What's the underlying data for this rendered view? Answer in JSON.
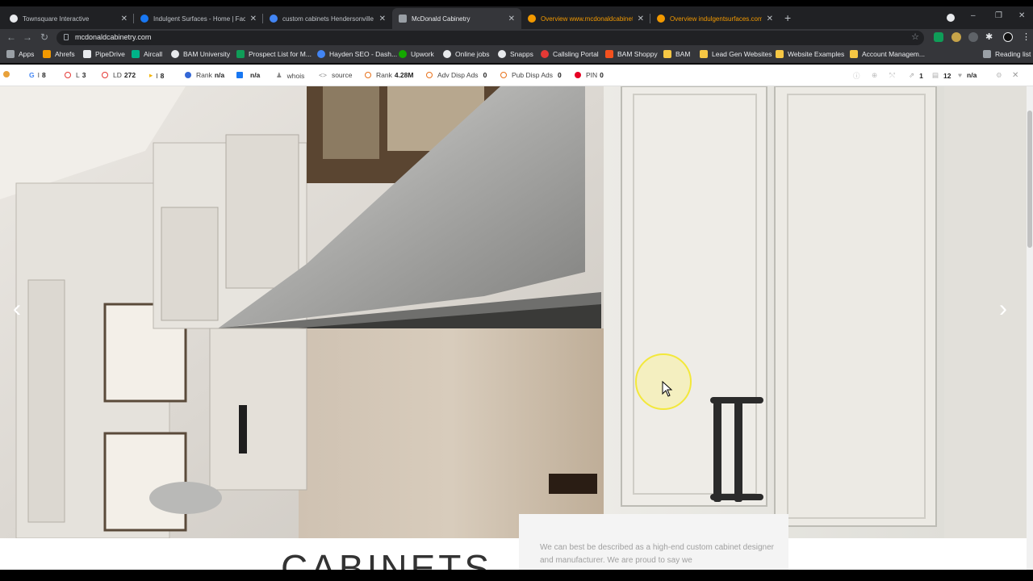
{
  "tabs": [
    {
      "title": "Townsquare Interactive",
      "favicon_color": "#ffffff"
    },
    {
      "title": "Indulgent Surfaces - Home | Face",
      "favicon_color": "#1877f2"
    },
    {
      "title": "custom cabinets Hendersonville",
      "favicon_color": "#4285f4"
    },
    {
      "title": "McDonald Cabinetry",
      "favicon_color": "#9aa0a6",
      "active": true
    },
    {
      "title": "Overview www.mcdonaldcabinetr",
      "favicon_color": "#f29900"
    },
    {
      "title": "Overview indulgentsurfaces.com",
      "favicon_color": "#f29900"
    }
  ],
  "window_controls": {
    "minimize": "–",
    "restore": "❐",
    "close": "✕"
  },
  "address_bar": {
    "url": "mcdonaldcabinetry.com"
  },
  "bookmarks": [
    {
      "label": "Apps",
      "icon_color": "#9aa0a6"
    },
    {
      "label": "Ahrefs",
      "icon_color": "#f29900"
    },
    {
      "label": "PipeDrive",
      "icon_color": "#222"
    },
    {
      "label": "Aircall",
      "icon_color": "#00b388"
    },
    {
      "label": "BAM University",
      "icon_color": "#e8eaed"
    },
    {
      "label": "Prospect List for M...",
      "icon_color": "#0f9d58"
    },
    {
      "label": "Hayden SEO - Dash...",
      "icon_color": "#4285f4"
    },
    {
      "label": "Upwork",
      "icon_color": "#14a800"
    },
    {
      "label": "Online jobs",
      "icon_color": "#e8eaed"
    },
    {
      "label": "Snapps",
      "icon_color": "#e8eaed"
    },
    {
      "label": "Callsling Portal",
      "icon_color": "#e53935"
    },
    {
      "label": "BAM Shoppy",
      "icon_color": "#f4511e"
    },
    {
      "label": "BAM",
      "icon_color": "#f6c744"
    },
    {
      "label": "Lead Gen Websites",
      "icon_color": "#f6c744"
    },
    {
      "label": "Website Examples",
      "icon_color": "#f6c744"
    },
    {
      "label": "Account Managem...",
      "icon_color": "#f6c744"
    }
  ],
  "reading_list": "Reading list",
  "seo_bar": {
    "g": {
      "label": "G",
      "value": "8"
    },
    "l": {
      "label": "L",
      "value": "3"
    },
    "ld": {
      "label": "LD",
      "value": "272"
    },
    "i": {
      "label": "I",
      "value": "8"
    },
    "rank": {
      "label": "Rank",
      "value": "n/a"
    },
    "fb": {
      "label": "",
      "value": "n/a"
    },
    "whois": "whois",
    "source": "source",
    "rank2": {
      "label": "Rank",
      "value": "4.28M"
    },
    "adv": {
      "label": "Adv Disp Ads",
      "value": "0"
    },
    "pub": {
      "label": "Pub Disp Ads",
      "value": "0"
    },
    "pin": {
      "label": "PIN",
      "value": "0"
    },
    "right": {
      "links": "1",
      "pages": "12",
      "value": "n/a"
    }
  },
  "hero": {
    "prev": "‹",
    "next": "›"
  },
  "content": {
    "heading": "CABINETS",
    "description": "We can best be described as a high-end custom cabinet designer and manufacturer. We are proud to say we"
  }
}
